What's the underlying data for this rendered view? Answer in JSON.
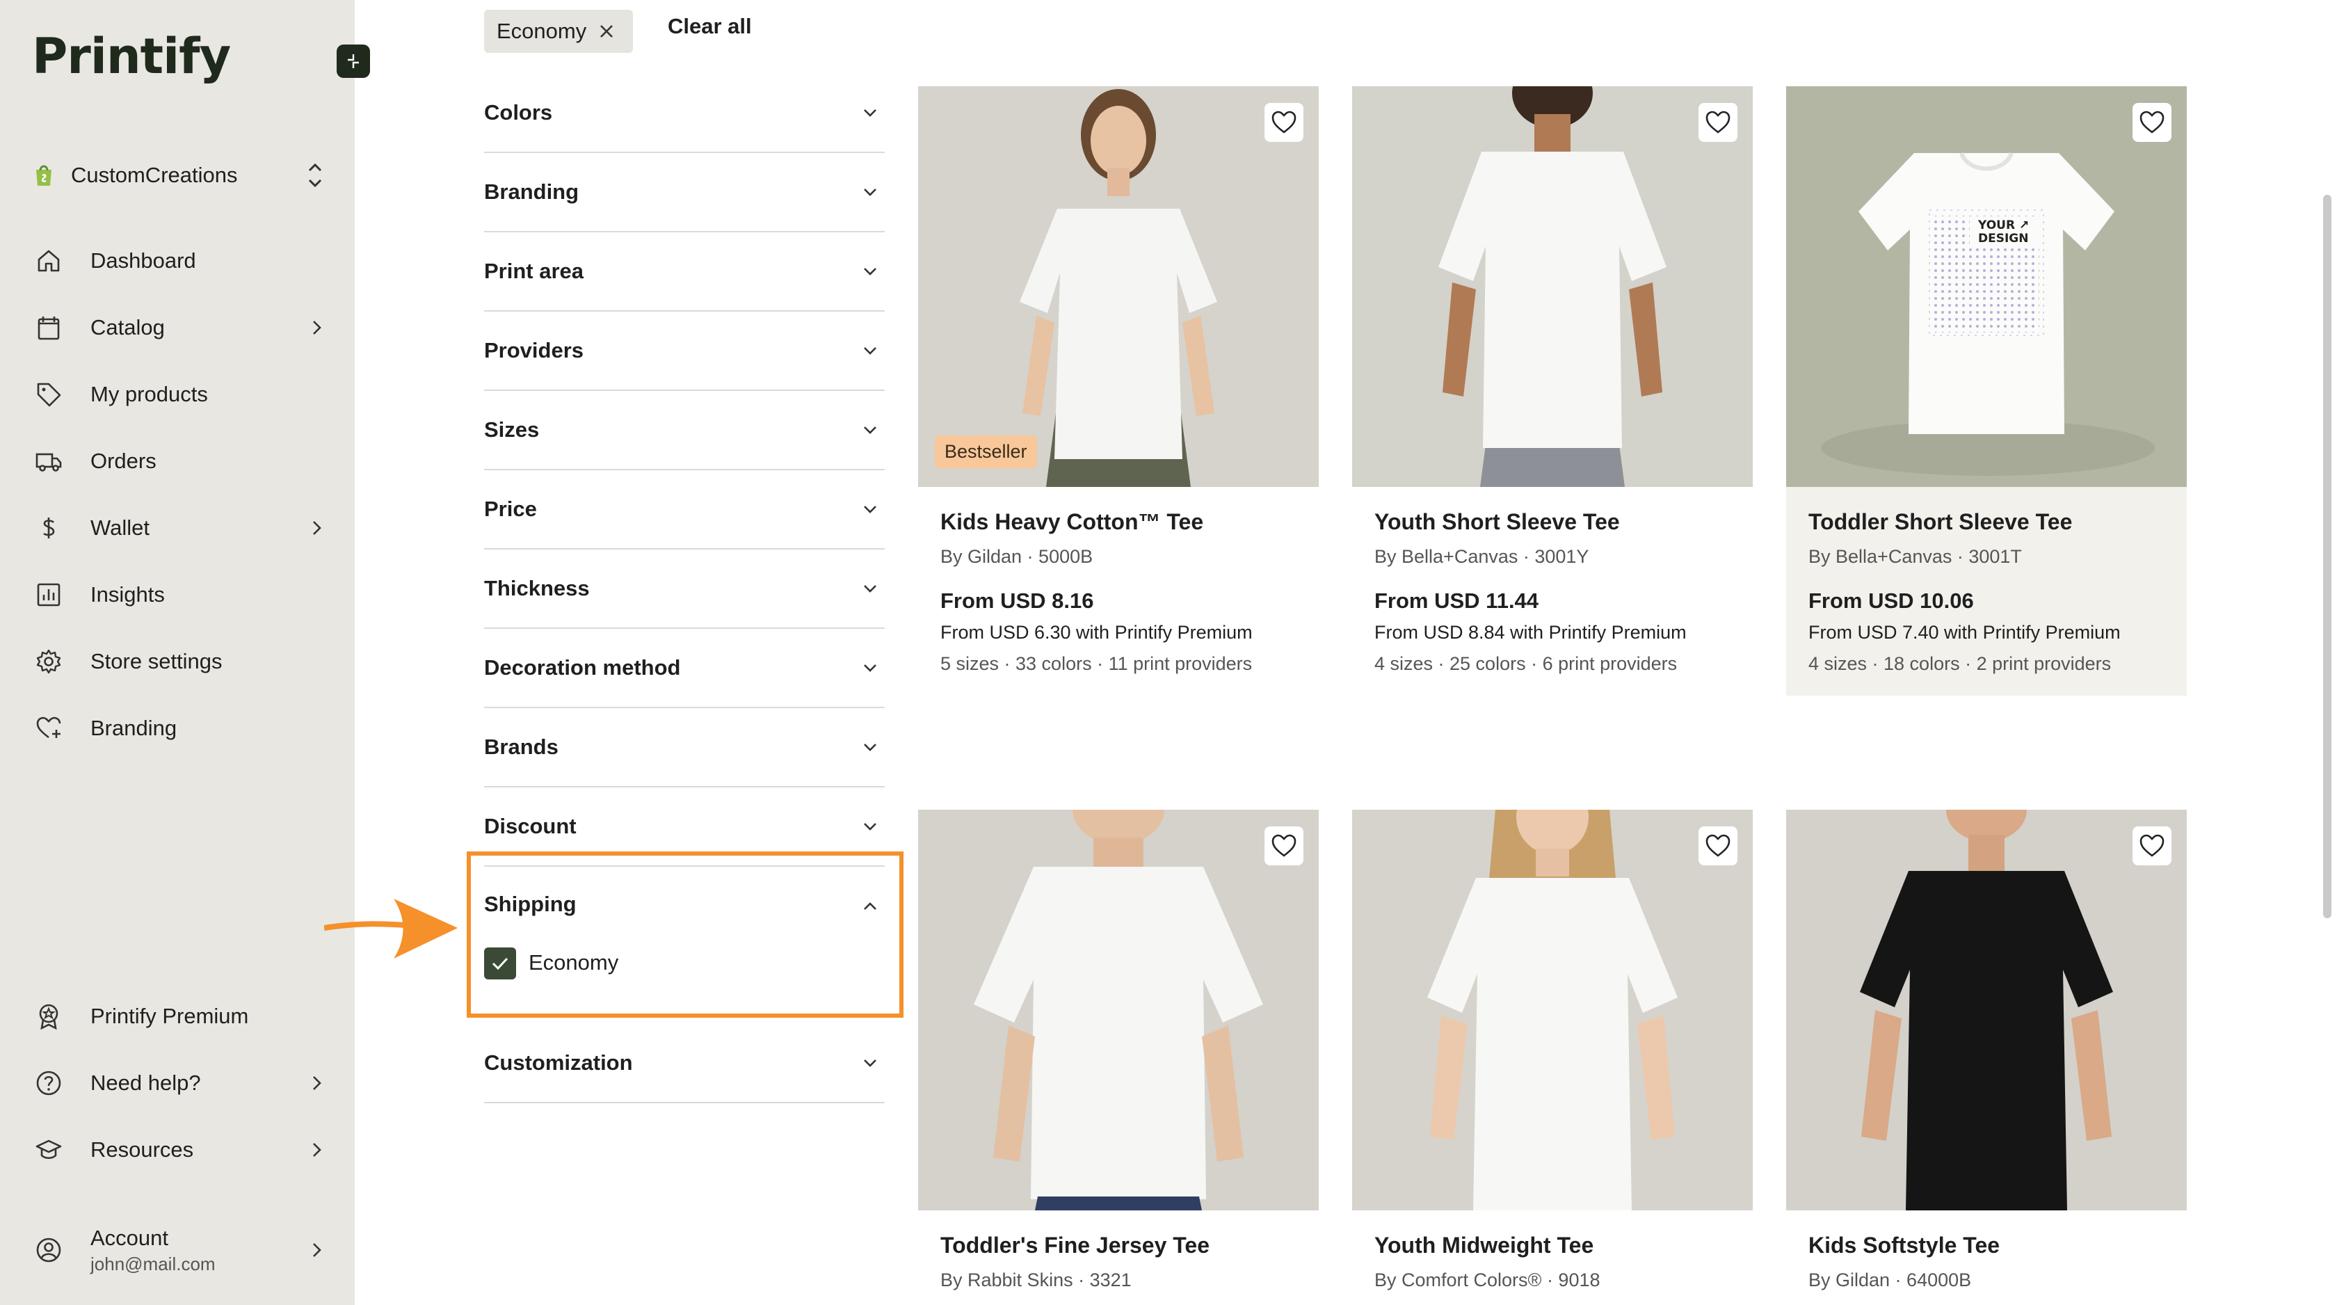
{
  "sidebar": {
    "logo": "Printify",
    "store_name": "CustomCreations",
    "nav": [
      {
        "label": "Dashboard",
        "icon": "home-icon"
      },
      {
        "label": "Catalog",
        "icon": "catalog-icon"
      },
      {
        "label": "My products",
        "icon": "tag-icon"
      },
      {
        "label": "Orders",
        "icon": "truck-icon"
      },
      {
        "label": "Wallet",
        "icon": "dollar-icon"
      },
      {
        "label": "Insights",
        "icon": "chart-icon"
      },
      {
        "label": "Store settings",
        "icon": "gear-icon"
      },
      {
        "label": "Branding",
        "icon": "heart-plus-icon"
      }
    ],
    "bottom": [
      {
        "label": "Printify Premium",
        "icon": "premium-badge-icon"
      },
      {
        "label": "Need help?",
        "icon": "help-icon"
      },
      {
        "label": "Resources",
        "icon": "graduation-icon"
      }
    ],
    "account": {
      "label": "Account",
      "email": "john@mail.com"
    }
  },
  "active_filter": {
    "label": "Economy",
    "clear_all": "Clear all"
  },
  "filters": [
    "Colors",
    "Branding",
    "Print area",
    "Providers",
    "Sizes",
    "Price",
    "Thickness",
    "Decoration method",
    "Brands",
    "Discount"
  ],
  "shipping": {
    "title": "Shipping",
    "option": "Economy",
    "checked": true
  },
  "customization": "Customization",
  "products": [
    {
      "name": "Kids Heavy Cotton™ Tee",
      "by": "By Gildan · 5000B",
      "price": "From USD 8.16",
      "premium": "From USD 6.30 with Printify Premium",
      "meta": "5 sizes · 33 colors · 11 print providers",
      "badge": "Bestseller"
    },
    {
      "name": "Youth Short Sleeve Tee",
      "by": "By Bella+Canvas · 3001Y",
      "price": "From USD 11.44",
      "premium": "From USD 8.84 with Printify Premium",
      "meta": "4 sizes · 25 colors · 6 print providers"
    },
    {
      "name": "Toddler Short Sleeve Tee",
      "by": "By Bella+Canvas · 3001T",
      "price": "From USD 10.06",
      "premium": "From USD 7.40 with Printify Premium",
      "meta": "4 sizes · 18 colors · 2 print providers",
      "design_text": "YOUR DESIGN"
    },
    {
      "name": "Toddler's Fine Jersey Tee",
      "by": "By Rabbit Skins · 3321"
    },
    {
      "name": "Youth Midweight Tee",
      "by": "By Comfort Colors® · 9018"
    },
    {
      "name": "Kids Softstyle Tee",
      "by": "By Gildan · 64000B"
    }
  ],
  "colors": {
    "accent": "#f5902a",
    "sidebar_bg": "#e9e7e1",
    "brand_dark": "#1f2a1c",
    "checkbox": "#3a4a36"
  }
}
